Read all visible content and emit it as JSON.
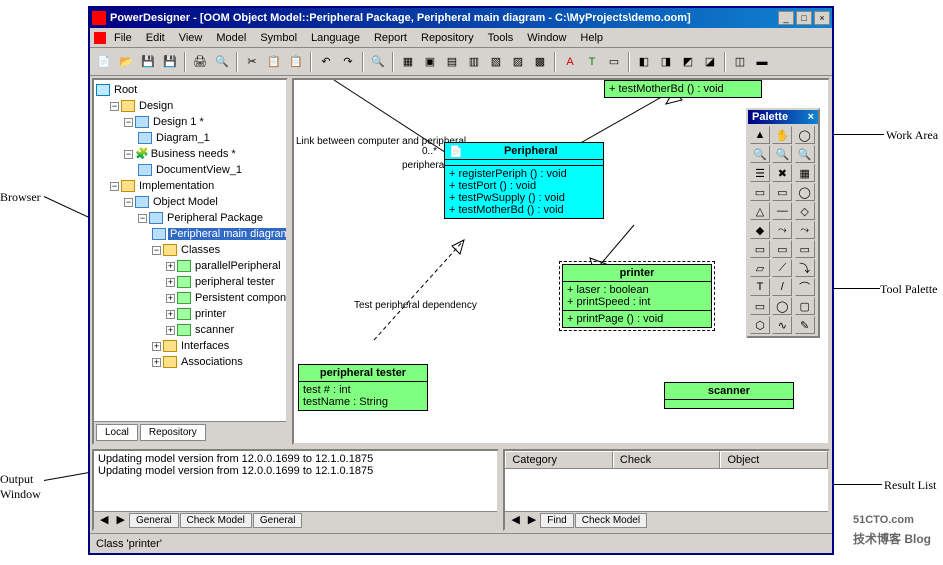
{
  "title": "PowerDesigner - [OOM Object Model::Peripheral Package, Peripheral main diagram - C:\\MyProjects\\demo.oom]",
  "menu": [
    "File",
    "Edit",
    "View",
    "Model",
    "Symbol",
    "Language",
    "Report",
    "Repository",
    "Tools",
    "Window",
    "Help"
  ],
  "tree": {
    "root": "Root",
    "design": "Design",
    "design1": "Design 1 *",
    "diagram1": "Diagram_1",
    "bizneeds": "Business needs *",
    "docview": "DocumentView_1",
    "impl": "Implementation",
    "om": "Object Model",
    "pp": "Peripheral Package",
    "pmd": "Peripheral main diagram",
    "classes": "Classes",
    "c1": "parallelPeripheral",
    "c2": "peripheral tester",
    "c3": "Persistent component",
    "c4": "printer",
    "c5": "scanner",
    "interfaces": "Interfaces",
    "assoc": "Associations"
  },
  "browserTabs": {
    "local": "Local",
    "repo": "Repository"
  },
  "canvas": {
    "peripheral": {
      "name": "Peripheral",
      "ops": [
        "+  registerPeriph ()  : void",
        "+  testPort ()  : void",
        "+  testPwSupply ()  : void",
        "+  testMotherBd ()  : void"
      ]
    },
    "topblock": {
      "op": "+  testMotherBd ()  : void"
    },
    "printer": {
      "name": "printer",
      "attrs": [
        "+  laser  : boolean",
        "+  printSpeed  : int"
      ],
      "ops": [
        "+  printPage ()  : void"
      ]
    },
    "ptester": {
      "name": "peripheral tester",
      "attrs": [
        "test #  : int",
        "testName  : String"
      ]
    },
    "scanner": {
      "name": "scanner"
    },
    "lbl_link": "Link between computer and peripheral",
    "lbl_peri": "peripheral",
    "lbl_card": "0..*",
    "lbl_dep": "Test peripheral dependency"
  },
  "palette": {
    "title": "Palette"
  },
  "output": {
    "l1": "Updating model version from 12.0.0.1699 to 12.1.0.1875",
    "l2": "Updating model version from 12.0.0.1699 to 12.1.0.1875",
    "tabs": [
      "General",
      "Check Model",
      "General"
    ]
  },
  "result": {
    "cols": [
      "Category",
      "Check",
      "Object"
    ],
    "tabs": [
      "Find",
      "Check Model"
    ]
  },
  "status": "Class 'printer'",
  "ann": {
    "browser": "Browser",
    "output": "Output\nWindow",
    "work": "Work Area",
    "palette": "Tool Palette",
    "result": "Result List"
  },
  "watermark": {
    "big": "51CTO.com",
    "small": "技术博客  Blog"
  }
}
